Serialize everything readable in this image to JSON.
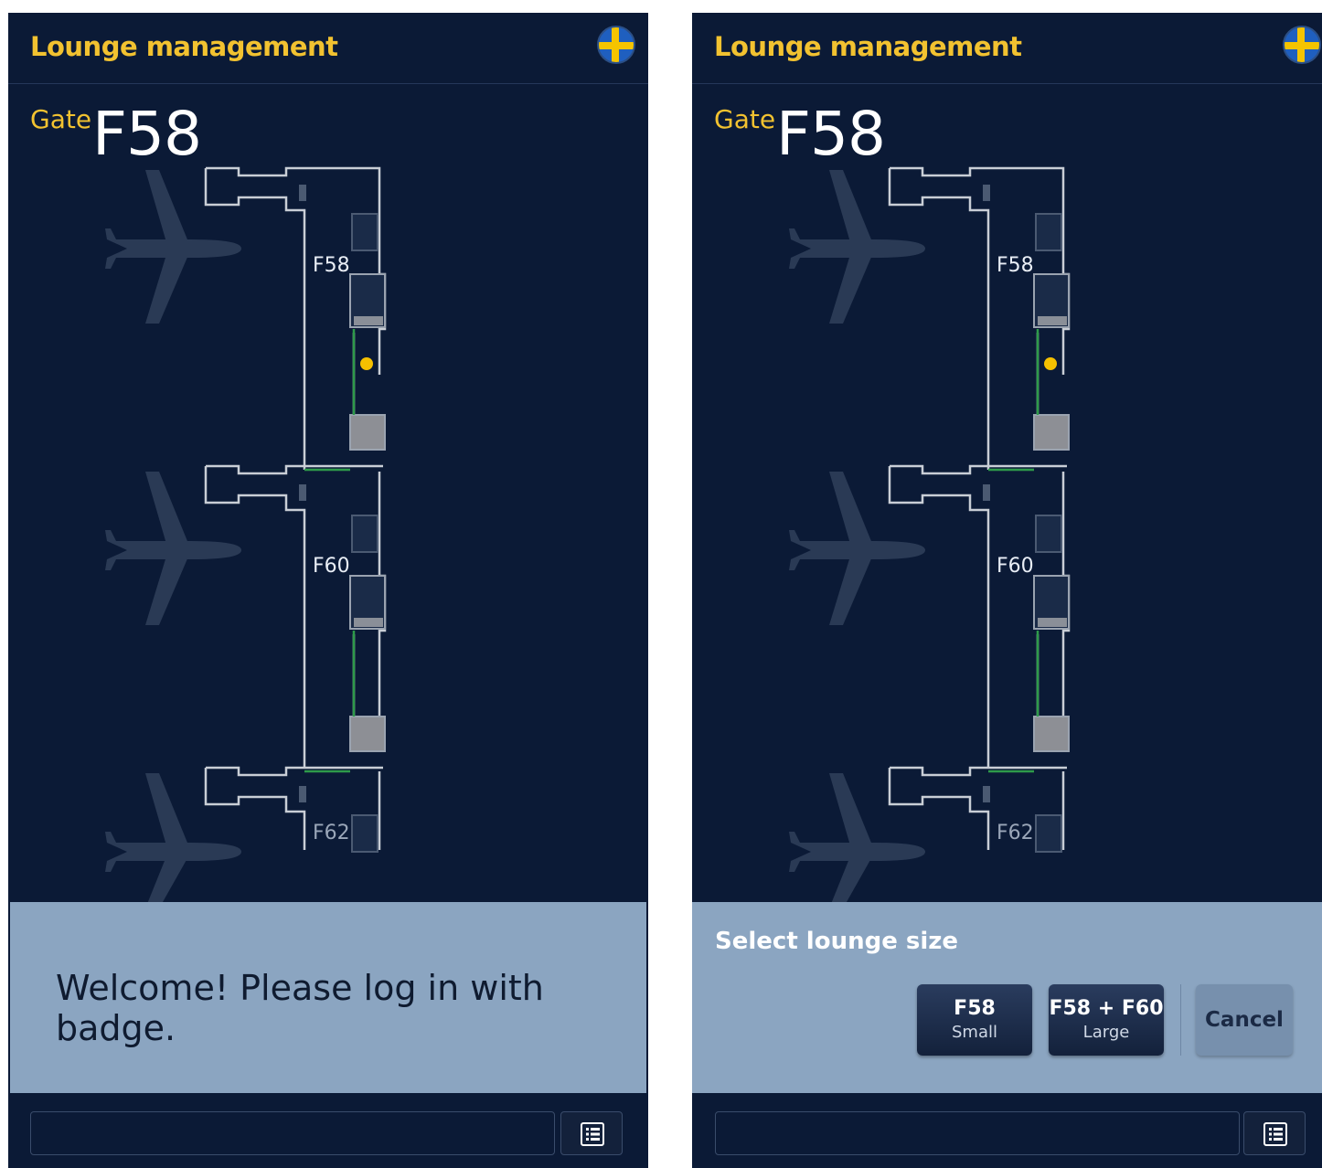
{
  "app": {
    "title": "Lounge management"
  },
  "gate": {
    "label": "Gate",
    "code": "F58"
  },
  "map": {
    "labels": [
      "F58",
      "F60",
      "F62"
    ]
  },
  "left_panel": {
    "message": "Welcome! Please log in with badge."
  },
  "right_panel": {
    "select_title": "Select lounge size",
    "options": [
      {
        "main": "F58",
        "sub": "Small"
      },
      {
        "main": "F58 + F60",
        "sub": "Large"
      }
    ],
    "cancel_label": "Cancel"
  },
  "footer": {
    "input_value": "",
    "button_icon": "list-icon"
  },
  "colors": {
    "background": "#0b1a36",
    "accent": "#f2c230",
    "sheet": "#8ba5c1"
  }
}
